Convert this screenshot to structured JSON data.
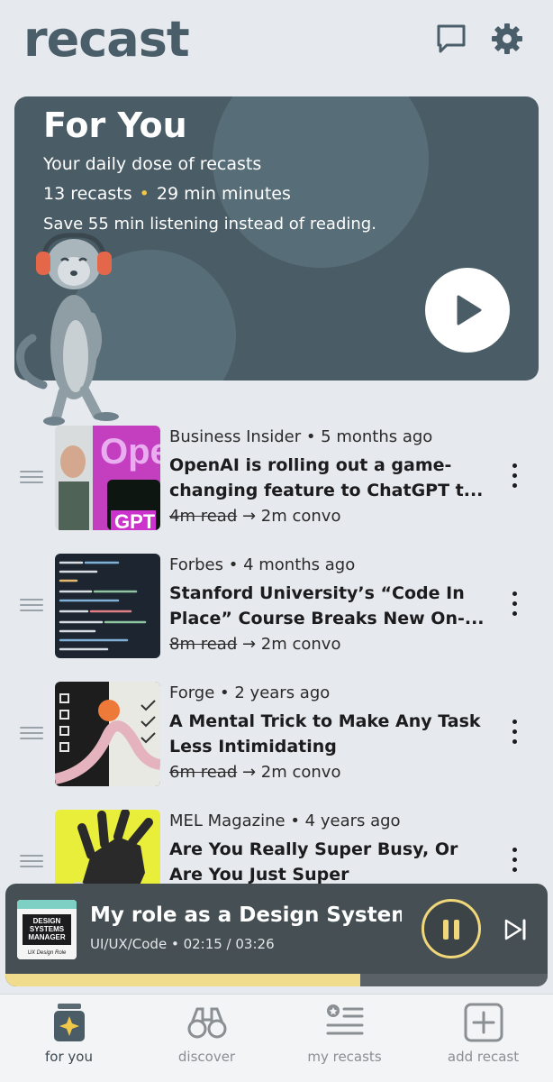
{
  "header": {
    "logo": "recast",
    "icons": [
      "chat-icon",
      "gear-icon"
    ]
  },
  "hero": {
    "title": "For You",
    "subtitle": "Your daily dose of recasts",
    "recast_count": "13 recasts",
    "duration": "29 min minutes",
    "savings": "Save 55 min listening instead of reading."
  },
  "items": [
    {
      "source": "Business Insider",
      "age": "5 months ago",
      "title": "OpenAI is rolling out a game-changing feature to ChatGPT t...",
      "read": "4m read",
      "convo": "2m convo"
    },
    {
      "source": "Forbes",
      "age": "4 months ago",
      "title": "Stanford University’s “Code In Place” Course Breaks New On-...",
      "read": "8m read",
      "convo": "2m convo"
    },
    {
      "source": "Forge",
      "age": "2 years ago",
      "title": "A Mental Trick to Make Any Task Less Intimidating",
      "read": "6m read",
      "convo": "2m convo"
    },
    {
      "source": "MEL Magazine",
      "age": "4 years ago",
      "title": "Are You Really Super Busy, Or Are You Just Super Disorganized?",
      "read": "",
      "convo": ""
    }
  ],
  "player": {
    "title": "My role as a Design Systems M",
    "category": "UI/UX/Code",
    "time": "02:15 / 03:26",
    "progress": 0.655,
    "art_lines": [
      "DESIGN",
      "SYSTEMS",
      "MANAGER"
    ],
    "art_caption": "UX Design Role"
  },
  "tabs": [
    {
      "label": "for you",
      "icon": "for-you-icon",
      "active": true
    },
    {
      "label": "discover",
      "icon": "binoculars-icon",
      "active": false
    },
    {
      "label": "my recasts",
      "icon": "list-icon",
      "active": false
    },
    {
      "label": "add recast",
      "icon": "add-icon",
      "active": false
    }
  ],
  "colors": {
    "accent": "#f2c84b",
    "hero_bg": "#4a5c66",
    "player_bg": "#454f54",
    "progress": "#f0dc8c"
  }
}
